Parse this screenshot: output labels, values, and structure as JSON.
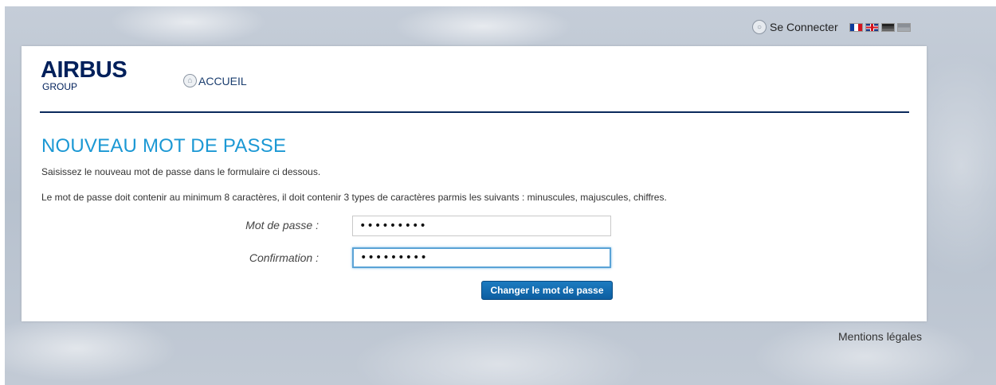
{
  "header": {
    "connect_label": "Se Connecter",
    "languages": [
      "fr",
      "en",
      "de",
      "other"
    ]
  },
  "brand": {
    "logo_main": "AIRBUS",
    "logo_sub": "GROUP",
    "color": "#00205b"
  },
  "nav": {
    "home_label": "ACCUEIL"
  },
  "page": {
    "title": "NOUVEAU MOT DE PASSE",
    "intro": "Saisissez le nouveau mot de passe dans le formulaire ci dessous.",
    "rules": "Le mot de passe doit contenir au minimum 8 caractères, il doit contenir 3 types de caractères parmis les suivants : minuscules, majuscules, chiffres.",
    "title_color": "#1b98d4"
  },
  "form": {
    "password_label": "Mot de passe :",
    "password_value": "•••••••••",
    "confirm_label": "Confirmation :",
    "confirm_value": "•••••••••",
    "submit_label": "Changer le mot de passe",
    "button_color": "#0d5ea1"
  },
  "footer": {
    "legal_label": "Mentions légales"
  },
  "icons": {
    "connect": "lock-icon",
    "home": "home-icon"
  }
}
